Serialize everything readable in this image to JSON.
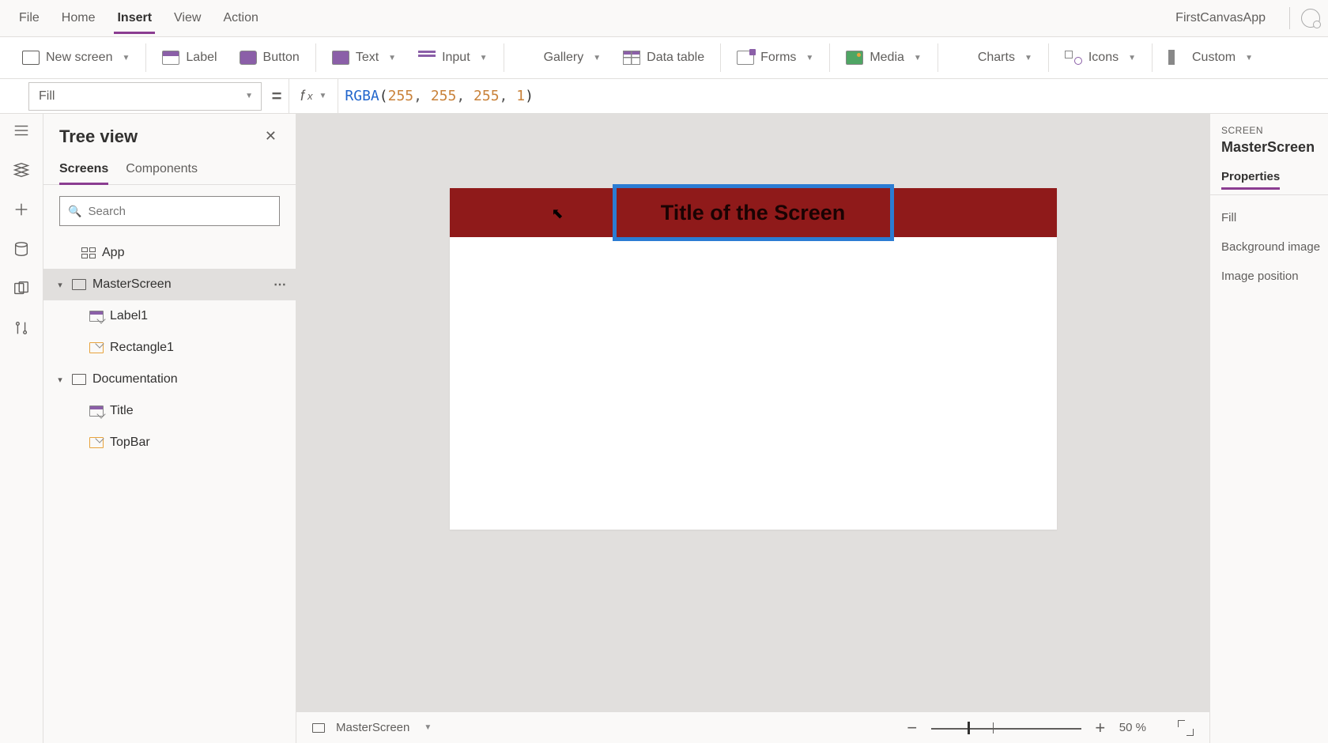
{
  "app_name": "FirstCanvasApp",
  "menu": {
    "items": [
      "File",
      "Home",
      "Insert",
      "View",
      "Action"
    ],
    "active_index": 2
  },
  "ribbon": {
    "new_screen": "New screen",
    "label": "Label",
    "button": "Button",
    "text": "Text",
    "input": "Input",
    "gallery": "Gallery",
    "data_table": "Data table",
    "forms": "Forms",
    "media": "Media",
    "charts": "Charts",
    "icons": "Icons",
    "custom": "Custom"
  },
  "formula": {
    "property": "Fill",
    "fn": "RGBA",
    "args": [
      "255",
      "255",
      "255",
      "1"
    ]
  },
  "tree": {
    "title": "Tree view",
    "tabs": [
      "Screens",
      "Components"
    ],
    "active_tab": 0,
    "search_placeholder": "Search",
    "app_node": "App",
    "screens": [
      {
        "name": "MasterScreen",
        "selected": true,
        "children": [
          {
            "name": "Label1",
            "icon": "label"
          },
          {
            "name": "Rectangle1",
            "icon": "rect"
          }
        ]
      },
      {
        "name": "Documentation",
        "selected": false,
        "children": [
          {
            "name": "Title",
            "icon": "label"
          },
          {
            "name": "TopBar",
            "icon": "rect"
          }
        ]
      }
    ]
  },
  "canvas": {
    "title_text": "Title of the Screen",
    "header_color": "#8f1a1a",
    "cursor_pointer": "⬉"
  },
  "status": {
    "screen_name": "MasterScreen",
    "zoom_percent": "50",
    "pct_suffix": "%"
  },
  "props": {
    "type_label": "SCREEN",
    "name": "MasterScreen",
    "tab": "Properties",
    "rows": [
      "Fill",
      "Background image",
      "Image position"
    ]
  }
}
